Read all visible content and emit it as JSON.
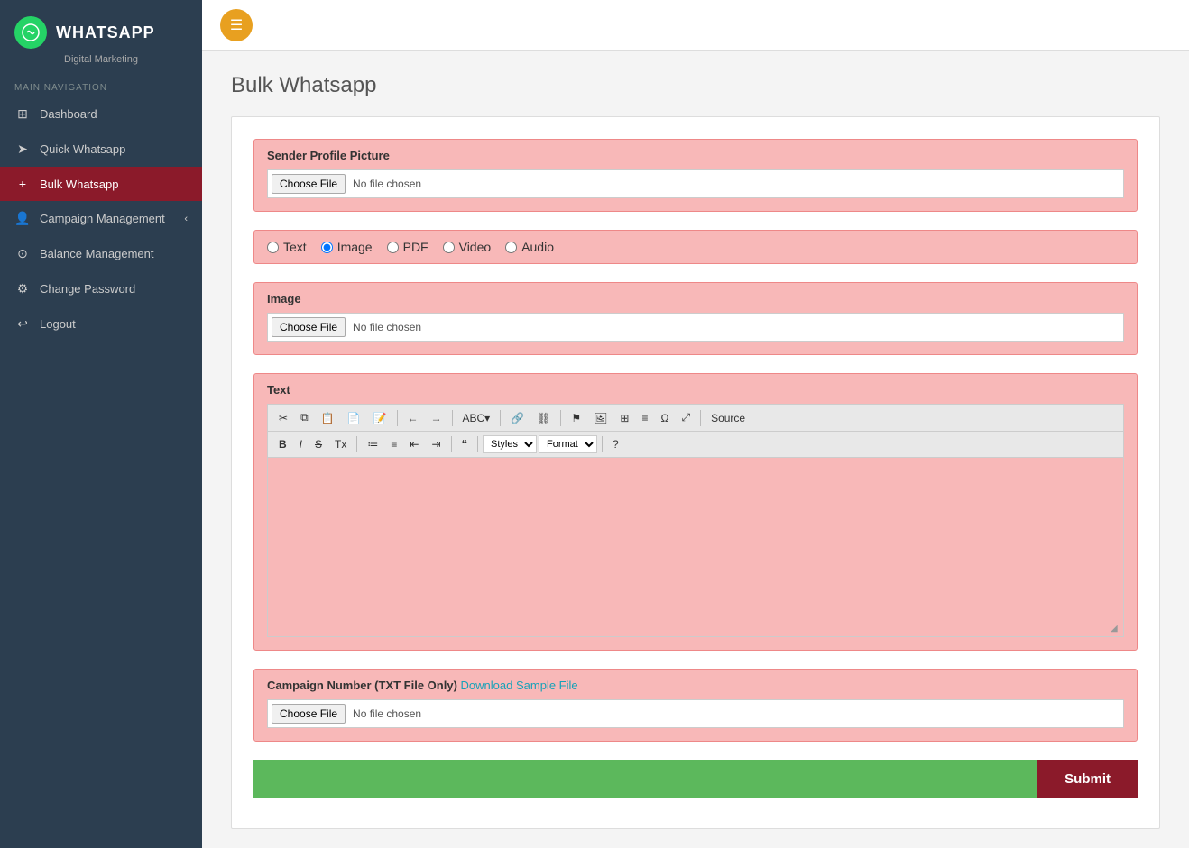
{
  "sidebar": {
    "logo_text": "WHATSAPP",
    "logo_subtitle": "Digital Marketing",
    "nav_label": "MAIN NAVIGATION",
    "items": [
      {
        "id": "dashboard",
        "label": "Dashboard",
        "icon": "⊞",
        "active": false
      },
      {
        "id": "quick-whatsapp",
        "label": "Quick Whatsapp",
        "icon": "➤",
        "active": false
      },
      {
        "id": "bulk-whatsapp",
        "label": "Bulk Whatsapp",
        "icon": "+",
        "active": true
      },
      {
        "id": "campaign-management",
        "label": "Campaign Management",
        "icon": "👤",
        "active": false
      },
      {
        "id": "balance-management",
        "label": "Balance Management",
        "icon": "⊙",
        "active": false
      },
      {
        "id": "change-password",
        "label": "Change Password",
        "icon": "⚙",
        "active": false
      },
      {
        "id": "logout",
        "label": "Logout",
        "icon": "⏎",
        "active": false
      }
    ]
  },
  "topbar": {
    "menu_icon": "☰"
  },
  "page": {
    "title": "Bulk Whatsapp"
  },
  "form": {
    "sender_profile_label": "Sender Profile Picture",
    "choose_file_1": "Choose File",
    "no_file_1": "No file chosen",
    "radio_options": [
      {
        "id": "text",
        "label": "Text",
        "checked": false
      },
      {
        "id": "image",
        "label": "Image",
        "checked": true
      },
      {
        "id": "pdf",
        "label": "PDF",
        "checked": false
      },
      {
        "id": "video",
        "label": "Video",
        "checked": false
      },
      {
        "id": "audio",
        "label": "Audio",
        "checked": false
      }
    ],
    "image_label": "Image",
    "choose_file_2": "Choose File",
    "no_file_2": "No file chosen",
    "text_label": "Text",
    "toolbar": {
      "buttons": [
        "✂",
        "⧉",
        "⊞",
        "⊟",
        "⊠",
        "←",
        "→",
        "ABC▾",
        "🔗",
        "🔗✕",
        "⚑",
        "🖼",
        "⊞",
        "≡",
        "Ω",
        "⤢",
        "📄",
        "Source"
      ],
      "bold": "B",
      "italic": "I",
      "strike": "S",
      "clear": "Tx",
      "ol": "≡",
      "ul": "≡",
      "indent_less": "⇤",
      "indent_more": "⇥",
      "quote": "❝❞",
      "styles_label": "Styles",
      "format_label": "Format",
      "help": "?"
    },
    "campaign_label": "Campaign Number (TXT File Only)",
    "download_link": "Download Sample File",
    "choose_file_3": "Choose File",
    "no_file_3": "No file chosen",
    "submit_label": "Submit"
  }
}
